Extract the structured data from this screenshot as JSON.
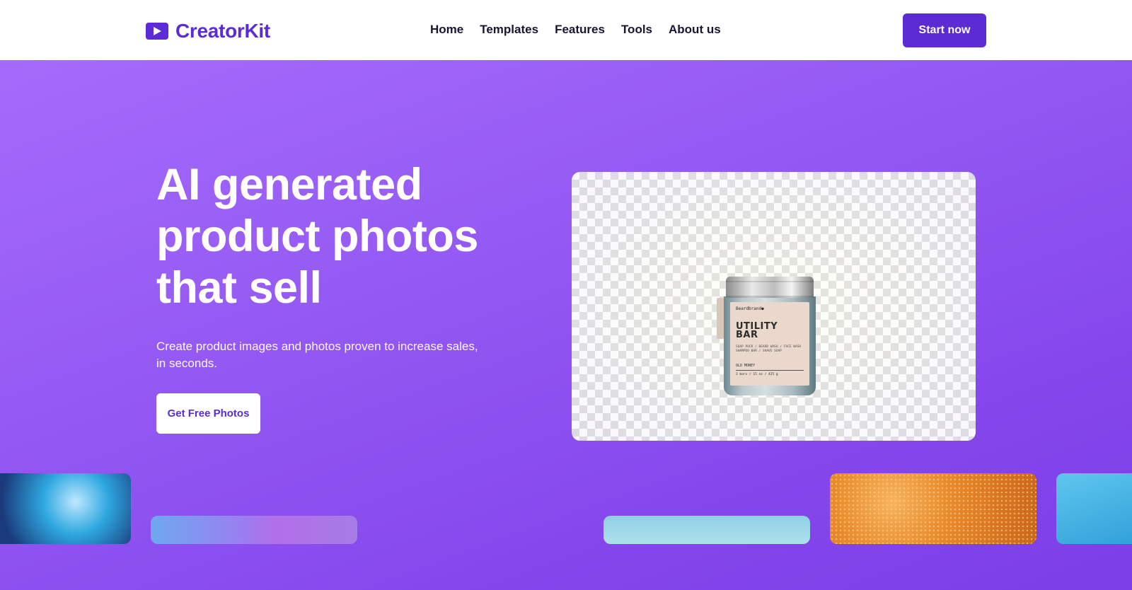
{
  "header": {
    "brand": "CreatorKit",
    "nav": [
      {
        "label": "Home"
      },
      {
        "label": "Templates"
      },
      {
        "label": "Features"
      },
      {
        "label": "Tools"
      },
      {
        "label": "About us"
      }
    ],
    "cta_label": "Start now"
  },
  "hero": {
    "headline_lines": [
      "AI generated",
      "product photos",
      "that sell"
    ],
    "subtext": "Create product images and photos proven to increase sales, in seconds.",
    "cta_label": "Get Free Photos"
  },
  "preview": {
    "product": {
      "brand": "Beardbrand●",
      "title_lines": [
        "UTILITY",
        "BAR"
      ],
      "desc_lines": [
        "SOAP PUCK / BEARD WASH / FACE WASH",
        "SHAMPOO BAR / SHAVE SOAP"
      ],
      "scent": "OLD MONEY",
      "weight": "3 bars / 15 oz / 425 g"
    }
  },
  "colors": {
    "brand": "#5b2bd4",
    "hero_start": "#a66bfb",
    "hero_end": "#7b3fe6",
    "nav_text": "#1a1433"
  },
  "icons": {
    "logo": "play-icon"
  }
}
